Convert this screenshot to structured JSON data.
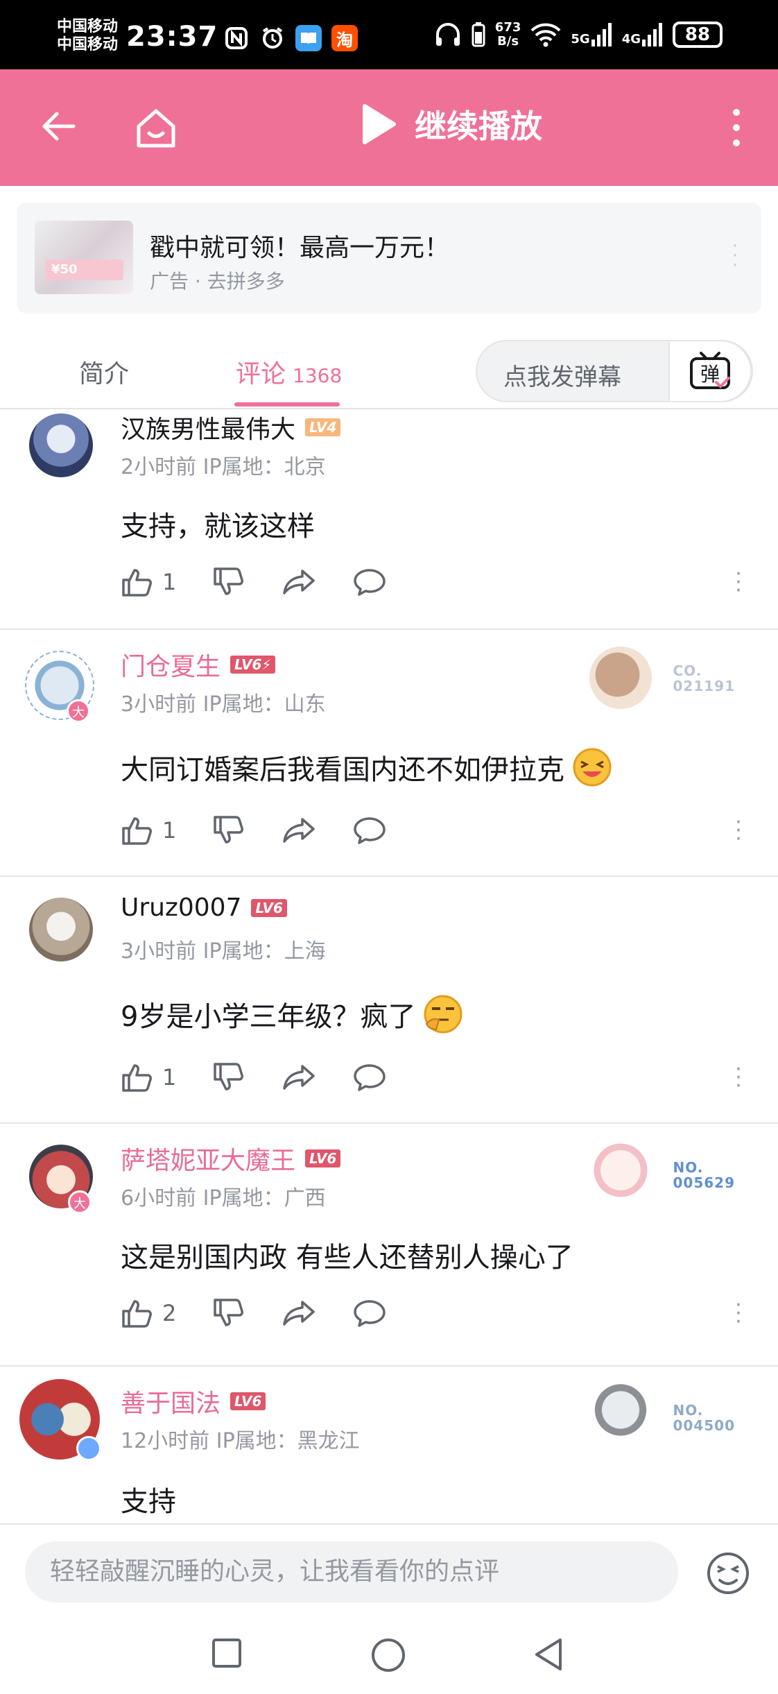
{
  "status_bar": {
    "carrier1": "中国移动",
    "carrier2": "中国移动",
    "time": "23:37",
    "app_icons": [
      "nfc-icon",
      "alarm-icon",
      "book-app-icon",
      "taobao-app-icon"
    ],
    "taobao_glyph": "淘",
    "speed_value": "673",
    "speed_unit": "B/s",
    "net1": "5G",
    "net2": "4G",
    "battery": "88"
  },
  "header": {
    "continue_play_label": "继续播放"
  },
  "ad": {
    "title": "戳中就可领！最高一万元！",
    "subtitle": "广告 · 去拼多多",
    "coupon_text": "¥50"
  },
  "tabs": {
    "intro_label": "简介",
    "comments_label": "评论",
    "comments_count": "1368"
  },
  "danmaku": {
    "placeholder": "点我发弹幕",
    "button_glyph": "弹"
  },
  "comments": [
    {
      "username": "汉族男性最伟大",
      "level": "LV4",
      "level_color": "#f6b77b",
      "time": "2小时前",
      "ip": "IP属地：北京",
      "text": "支持，就该这样",
      "likes": "1"
    },
    {
      "username": "门仓夏生",
      "level": "LV6⚡",
      "level_color": "#e0566b",
      "time": "3小时前",
      "ip": "IP属地：山东",
      "text": "大同订婚案后我看国内还不如伊拉克",
      "likes": "1",
      "fan_badge_line1": "CO.",
      "fan_badge_line2": "021191"
    },
    {
      "username": "Uruz0007",
      "level": "LV6",
      "level_color": "#e0566b",
      "time": "3小时前",
      "ip": "IP属地：上海",
      "text": "9岁是小学三年级？疯了",
      "likes": "1"
    },
    {
      "username": "萨塔妮亚大魔王",
      "level": "LV6",
      "level_color": "#e0566b",
      "time": "6小时前",
      "ip": "IP属地：广西",
      "text": "这是别国内政 有些人还替别人操心了",
      "likes": "2",
      "fan_badge_line1": "NO.",
      "fan_badge_line2": "005629"
    },
    {
      "username": "善于国法",
      "level": "LV6",
      "level_color": "#e0566b",
      "time": "12小时前",
      "ip": "IP属地：黑龙江",
      "text": "支持",
      "likes": "",
      "fan_badge_line1": "NO.",
      "fan_badge_line2": "004500"
    }
  ],
  "bottom_input": {
    "placeholder": "轻轻敲醒沉睡的心灵，让我看看你的点评"
  },
  "colors": {
    "brand_pink": "#f07197",
    "username_pink": "#e86c94",
    "gray_text": "#9499a0"
  }
}
